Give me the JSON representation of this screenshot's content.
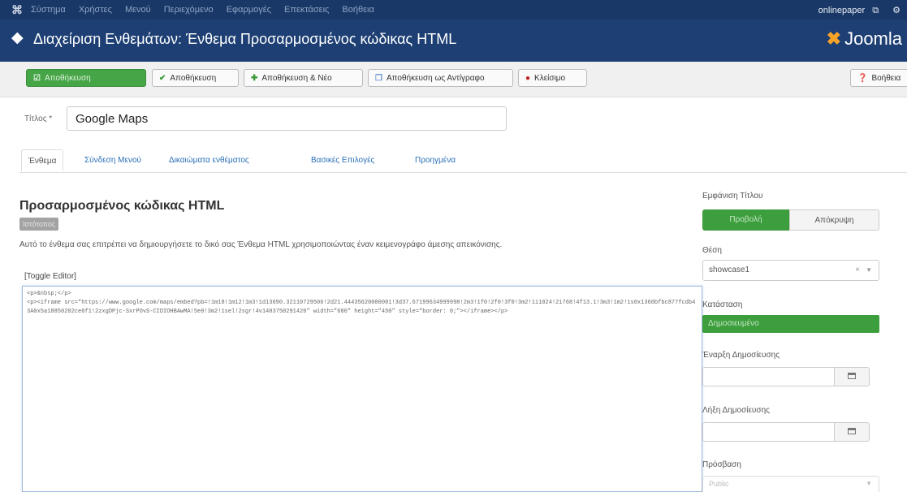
{
  "topbar": {
    "menu": [
      "Σύστημα",
      "Χρήστες",
      "Μενού",
      "Περιεχόμενο",
      "Εφαρμογές",
      "Επεκτάσεις",
      "Βοήθεια"
    ],
    "site_name": "onlinepaper",
    "site_link_icon": "⧉",
    "user_icon": "⚙"
  },
  "header": {
    "page_title": "Διαχείριση Ενθεμάτων: Ένθεμα Προσαρμοσμένος κώδικας HTML",
    "brand": "Joomla"
  },
  "toolbar": {
    "save": "Αποθήκευση",
    "save_close": "Αποθήκευση",
    "save_new": "Αποθήκευση & Νέο",
    "save_copy": "Αποθήκευση ως Αντίγραφο",
    "close": "Κλείσιμο",
    "help": "Βοήθεια"
  },
  "form": {
    "title_label": "Τίτλος *",
    "title_value": "Google Maps"
  },
  "tabs": [
    "Ένθεμα",
    "Σύνδεση Μενού",
    "Δικαιώματα ενθέματος",
    "Βασικές Επιλογές",
    "Προηγμένα"
  ],
  "module": {
    "heading": "Προσαρμοσμένος κώδικας HTML",
    "badge": "Ιστότοπος",
    "description": "Αυτό το ένθεμα σας επιτρέπει να δημιουργήσετε το δικό σας Ένθεμα HTML χρησιμοποιώντας έναν κειμενογράφο άμεσης απεικόνισης.",
    "toggle_editor": "[Toggle Editor]",
    "code": "<p>&nbsp;</p>\n<p><iframe src=\"https://www.google.com/maps/embed?pb=!1m18!1m12!1m3!1d13690.32110729506!2d21.44435620000001!3d37.67199634999998!2m3!1f0!2f0!3f0!3m2!1i1024!2i768!4f13.1!3m3!1m2!1s0x1360bfbc877fcdb43A0x5a18850202ce6f1!2zxgDPjc-SxrPOvS-CIDIOHBAwMA!5e0!3m2!1sel!2sgr!4v1403750291420\" width=\"600\" height=\"450\" style=\"border: 0;\"></iframe></p>"
  },
  "sidebar": {
    "show_title_label": "Εμφάνιση Τίτλου",
    "show_label": "Προβολή",
    "hide_label": "Απόκρυψη",
    "position_label": "Θέση",
    "position_value": "showcase1",
    "position_clear": "×",
    "status_label": "Κατάσταση",
    "status_value": "Δημοσιευμένο",
    "publish_up_label": "Έναρξη Δημοσίευσης",
    "publish_down_label": "Λήξη Δημοσίευσης",
    "access_label": "Πρόσβαση",
    "access_value": "Public"
  }
}
